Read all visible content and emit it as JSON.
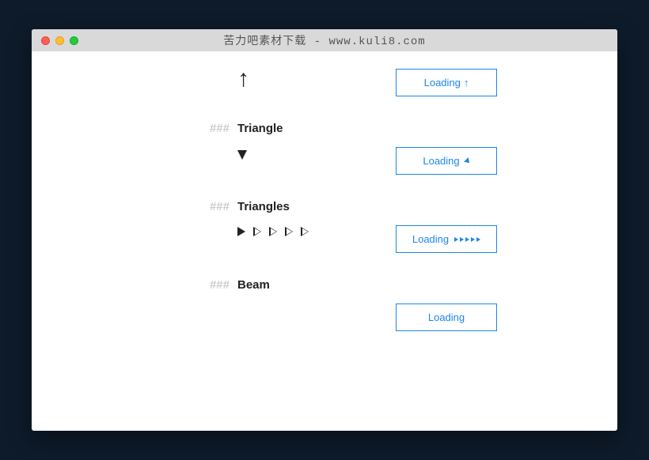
{
  "window": {
    "title": "苦力吧素材下载 - www.kuli8.com"
  },
  "sections": {
    "arrow": {
      "btn_label": "Loading",
      "btn_glyph": "↑"
    },
    "triangle": {
      "hash": "###",
      "heading": "Triangle",
      "btn_label": "Loading"
    },
    "triangles": {
      "hash": "###",
      "heading": "Triangles",
      "btn_label": "Loading"
    },
    "beam": {
      "hash": "###",
      "heading": "Beam",
      "btn_label": "Loading"
    }
  }
}
